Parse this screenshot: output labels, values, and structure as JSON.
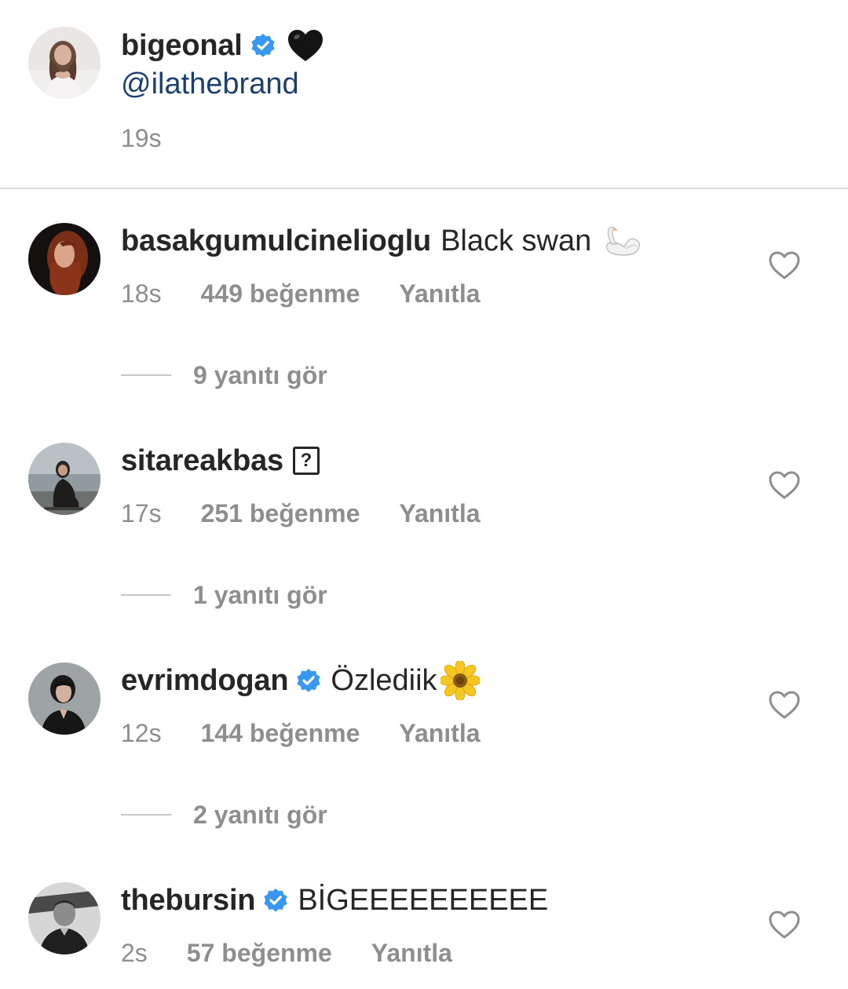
{
  "caption": {
    "username": "bigeonal",
    "verified": true,
    "heart_emoji": "black-heart",
    "mention": "@ilathebrand",
    "time": "19s"
  },
  "comments": [
    {
      "username": "basakgumulcinelioglu",
      "verified": false,
      "text": "Black swan",
      "emoji": "swan",
      "time": "18s",
      "likes": "449 beğenme",
      "reply": "Yanıtla",
      "view_replies": "9 yanıtı gör"
    },
    {
      "username": "sitareakbas",
      "verified": false,
      "text": "",
      "emoji": "unsupported-glyph",
      "glyph": "?",
      "time": "17s",
      "likes": "251 beğenme",
      "reply": "Yanıtla",
      "view_replies": "1 yanıtı gör"
    },
    {
      "username": "evrimdogan",
      "verified": true,
      "text": "Özlediik",
      "emoji": "sunflower",
      "time": "12s",
      "likes": "144 beğenme",
      "reply": "Yanıtla",
      "view_replies": "2 yanıtı gör"
    },
    {
      "username": "thebursin",
      "verified": true,
      "text": "BİGEEEEEEEEEE",
      "time": "2s",
      "likes": "57 beğenme",
      "reply": "Yanıtla"
    }
  ],
  "colors": {
    "text": "#262626",
    "secondary": "#8e8e8e",
    "mention": "#1c3f6e",
    "verified": "#3897f0",
    "divider": "#dbdbdb"
  }
}
